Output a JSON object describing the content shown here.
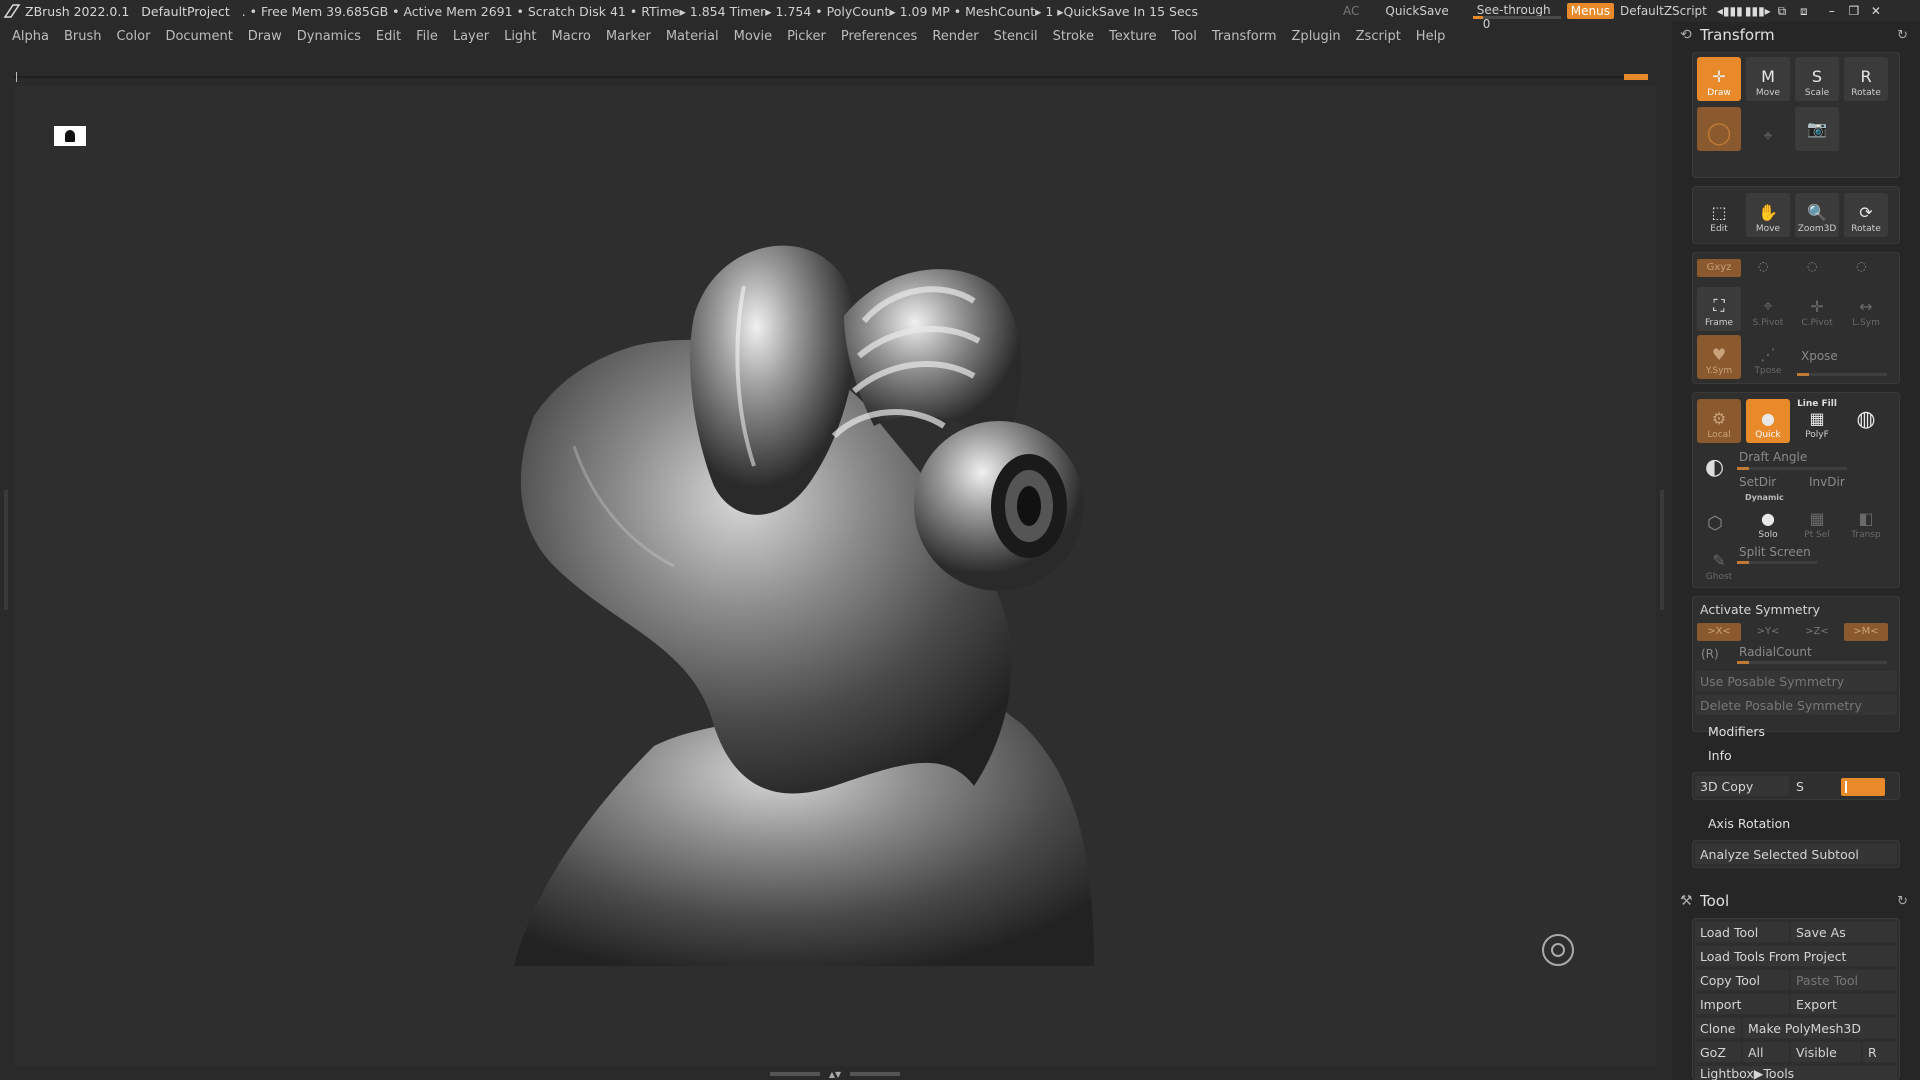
{
  "titlebar": {
    "app": "ZBrush 2022.0.1",
    "project": "DefaultProject",
    "status": ". • Free Mem 39.685GB • Active Mem 2691 • Scratch Disk 41 •  RTime▸ 1.854 Timer▸ 1.754 • PolyCount▸ 1.09 MP  • MeshCount▸ 1   ▸QuickSave In 15 Secs",
    "ac": "AC",
    "quicksave": "QuickSave",
    "see_through_label": "See-through",
    "see_through_value": "0",
    "see_through_level": 0,
    "menus": "Menus",
    "script": "DefaultZScript"
  },
  "menubar": [
    "Alpha",
    "Brush",
    "Color",
    "Document",
    "Draw",
    "Dynamics",
    "Edit",
    "File",
    "Layer",
    "Light",
    "Macro",
    "Marker",
    "Material",
    "Movie",
    "Picker",
    "Preferences",
    "Render",
    "Stencil",
    "Stroke",
    "Texture",
    "Tool",
    "Transform",
    "Zplugin",
    "Zscript",
    "Help"
  ],
  "transform": {
    "title": "Transform",
    "row1": [
      {
        "label": "Draw",
        "icon": "draw-icon",
        "state": "active"
      },
      {
        "label": "Move",
        "icon": "move-icon"
      },
      {
        "label": "Scale",
        "icon": "scale-icon"
      },
      {
        "label": "Rotate",
        "icon": "rotate-icon"
      }
    ],
    "row2_icons": [
      "material-sphere-icon",
      "edit-icon",
      "snapshot-camera-icon"
    ],
    "row3": [
      {
        "label": "Edit",
        "icon": "edit-icon"
      },
      {
        "label": "Move",
        "icon": "hand-move-icon"
      },
      {
        "label": "Zoom3D",
        "icon": "zoom3d-icon"
      },
      {
        "label": "Rotate",
        "icon": "rotate3d-icon"
      }
    ],
    "gxyz": "Gxyz",
    "frame": "Frame",
    "spivot": "S.Pivot",
    "cpivot": "C.Pivot",
    "lsym": "L.Sym",
    "ysym": "Y.Sym",
    "tpose": "Tpose",
    "xpose": "Xpose",
    "local": "Local",
    "quick": "Quick",
    "line_fill": "Line Fill",
    "polyf": "PolyF",
    "draft_angle": "Draft Angle",
    "setdir": "SetDir",
    "invdir": "InvDir",
    "dynamic": "Dynamic",
    "solo": "Solo",
    "ptsel": "Pt Sel",
    "transp": "Transp",
    "ghost": "Ghost",
    "split_screen": "Split Screen",
    "activate_symmetry": "Activate Symmetry",
    "sym_axes": [
      ">X<",
      ">Y<",
      ">Z<",
      ">M<"
    ],
    "r_label": "(R)",
    "radial_count": "RadialCount",
    "use_posable": "Use Posable Symmetry",
    "delete_posable": "Delete Posable Symmetry",
    "modifiers": "Modifiers",
    "info": "Info",
    "copy3d": "3D Copy",
    "s_label": "S",
    "axis_rotation": "Axis Rotation",
    "analyze": "Analyze Selected Subtool"
  },
  "tool": {
    "title": "Tool",
    "load_tool": "Load Tool",
    "save_as": "Save As",
    "load_from_project": "Load Tools From Project",
    "copy_tool": "Copy Tool",
    "paste_tool": "Paste Tool",
    "import": "Import",
    "export": "Export",
    "clone": "Clone",
    "make_polymesh": "Make PolyMesh3D",
    "goz": "GoZ",
    "all": "All",
    "visible": "Visible",
    "r": "R",
    "lightbox": "Lightbox▶Tools"
  }
}
